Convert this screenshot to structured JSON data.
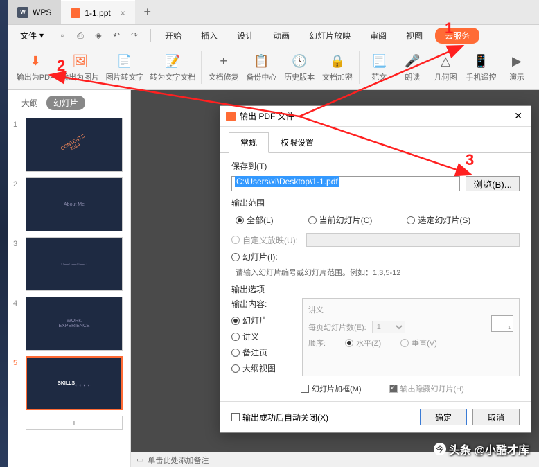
{
  "titlebar": {
    "home_label": "WPS",
    "file_tab": "1-1.ppt"
  },
  "menubar": {
    "file": "文件",
    "items": [
      "开始",
      "插入",
      "设计",
      "动画",
      "幻灯片放映",
      "审阅",
      "视图"
    ],
    "cloud": "云服务"
  },
  "ribbon": [
    {
      "label": "输出为PDF",
      "id": "export-pdf"
    },
    {
      "label": "输出为图片",
      "id": "export-image"
    },
    {
      "label": "图片转文字",
      "id": "ocr"
    },
    {
      "label": "转为文字文档",
      "id": "to-doc"
    },
    {
      "label": "文档修复",
      "id": "repair"
    },
    {
      "label": "备份中心",
      "id": "backup"
    },
    {
      "label": "历史版本",
      "id": "history"
    },
    {
      "label": "文档加密",
      "id": "encrypt"
    },
    {
      "label": "范文",
      "id": "template"
    },
    {
      "label": "朗读",
      "id": "read"
    },
    {
      "label": "几何图",
      "id": "geometry"
    },
    {
      "label": "手机遥控",
      "id": "remote"
    },
    {
      "label": "演示",
      "id": "present"
    }
  ],
  "sidebar": {
    "tab_outline": "大纲",
    "tab_slides": "幻灯片",
    "slide_count": 5
  },
  "notes": {
    "placeholder": "单击此处添加备注"
  },
  "dialog": {
    "title": "输出 PDF 文件",
    "tabs": {
      "general": "常规",
      "perm": "权限设置"
    },
    "save_to": "保存到(T)",
    "path": "C:\\Users\\xi\\Desktop\\1-1.pdf",
    "browse": "浏览(B)...",
    "range_title": "输出范围",
    "range_all": "全部(L)",
    "range_current": "当前幻灯片(C)",
    "range_selected": "选定幻灯片(S)",
    "range_custom": "自定义放映(U):",
    "range_slides": "幻灯片(I):",
    "range_hint": "请输入幻灯片编号或幻灯片范围。例如：1,3,5-12",
    "options_title": "输出选项",
    "content_title": "输出内容:",
    "content_slides": "幻灯片",
    "content_handout": "讲义",
    "content_notes": "备注页",
    "content_outline": "大纲视图",
    "handout_title": "讲义",
    "per_page": "每页幻灯片数(E):",
    "per_page_val": "1",
    "order": "顺序:",
    "order_h": "水平(Z)",
    "order_v": "垂直(V)",
    "frame": "幻灯片加框(M)",
    "hidden": "输出隐藏幻灯片(H)",
    "auto_close": "输出成功后自动关闭(X)",
    "ok": "确定",
    "cancel": "取消"
  },
  "annotations": {
    "a1": "1",
    "a2": "2",
    "a3": "3"
  },
  "watermark": "头条 @小酷才库"
}
